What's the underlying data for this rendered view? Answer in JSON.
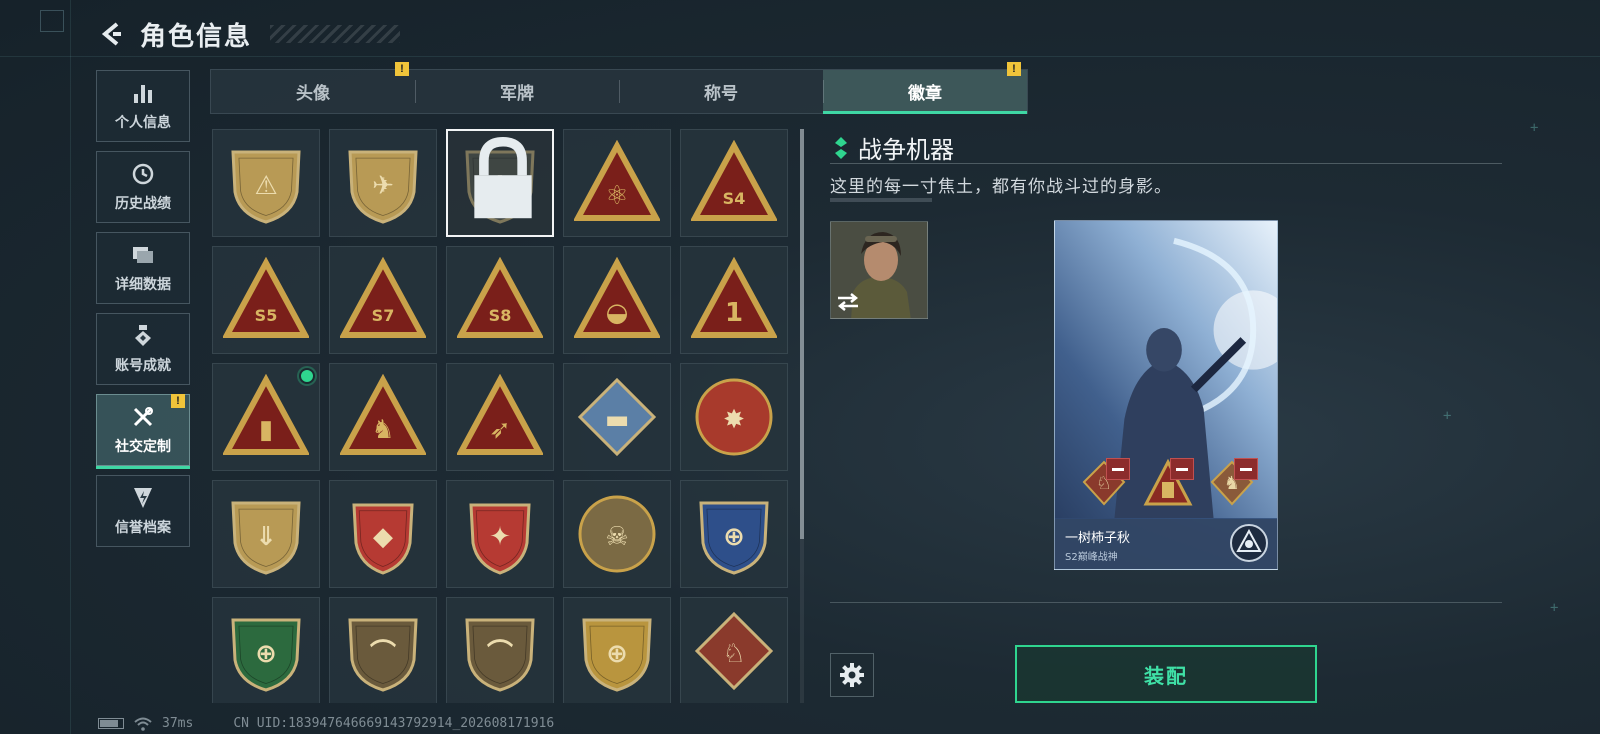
{
  "header": {
    "title": "角色信息"
  },
  "nav": {
    "items": [
      {
        "label": "个人信息",
        "icon": "bar-chart-icon",
        "active": false
      },
      {
        "label": "历史战绩",
        "icon": "history-icon",
        "active": false
      },
      {
        "label": "详细数据",
        "icon": "folder-icon",
        "active": false
      },
      {
        "label": "账号成就",
        "icon": "medal-icon",
        "active": false
      },
      {
        "label": "社交定制",
        "icon": "tools-icon",
        "active": true,
        "warning": true
      },
      {
        "label": "信誉档案",
        "icon": "shield-lightning-icon",
        "active": false
      }
    ],
    "warning_glyph": "!"
  },
  "tabs": [
    {
      "label": "头像",
      "warning": true,
      "active": false
    },
    {
      "label": "军牌",
      "warning": false,
      "active": false
    },
    {
      "label": "称号",
      "warning": false,
      "active": false
    },
    {
      "label": "徽章",
      "warning": true,
      "active": true
    }
  ],
  "badges": [
    {
      "name": "badge-shield-triangle",
      "shape": "shield",
      "color": "#b89a55",
      "symbol": "⚠",
      "selected": false
    },
    {
      "name": "badge-helicopter",
      "shape": "shield",
      "color": "#b89a55",
      "symbol": "✈",
      "selected": false
    },
    {
      "name": "badge-dagger",
      "shape": "shield",
      "color": "#55584e",
      "symbol": "†",
      "selected": true,
      "locked": true
    },
    {
      "name": "badge-atom",
      "shape": "triangle",
      "color": "#c9a24a",
      "symbol": "⚛",
      "selected": false
    },
    {
      "name": "badge-s4",
      "shape": "triangle",
      "color": "#c9a24a",
      "symbol": "S4",
      "selected": false
    },
    {
      "name": "badge-s5",
      "shape": "triangle",
      "color": "#c9a24a",
      "symbol": "S5",
      "selected": false
    },
    {
      "name": "badge-s7",
      "shape": "triangle",
      "color": "#c9a24a",
      "symbol": "S7",
      "selected": false
    },
    {
      "name": "badge-s8",
      "shape": "triangle",
      "color": "#c9a24a",
      "symbol": "S8",
      "selected": false
    },
    {
      "name": "badge-nest",
      "shape": "triangle",
      "color": "#c9a24a",
      "symbol": "◒",
      "selected": false
    },
    {
      "name": "badge-number-one",
      "shape": "triangle",
      "color": "#c9a24a",
      "symbol": "1",
      "selected": false
    },
    {
      "name": "badge-usb",
      "shape": "triangle",
      "color": "#c9a24a",
      "symbol": "▮",
      "selected": false,
      "new": true
    },
    {
      "name": "badge-soldiers",
      "shape": "triangle",
      "color": "#c9a24a",
      "symbol": "♞",
      "selected": false
    },
    {
      "name": "badge-rocket",
      "shape": "triangle",
      "color": "#c9a24a",
      "symbol": "➶",
      "selected": false
    },
    {
      "name": "badge-tank",
      "shape": "diamond",
      "color": "#5b7fa6",
      "symbol": "▬",
      "selected": false
    },
    {
      "name": "badge-star-skull",
      "shape": "circle",
      "color": "#a83a2c",
      "symbol": "✸",
      "selected": false
    },
    {
      "name": "badge-arrow-shield",
      "shape": "shield",
      "color": "#b89a55",
      "symbol": "⇓",
      "selected": false
    },
    {
      "name": "badge-red-crest-1",
      "shape": "crest",
      "color": "#b63a33",
      "symbol": "◆",
      "selected": false
    },
    {
      "name": "badge-red-crest-2",
      "shape": "crest",
      "color": "#b63a33",
      "symbol": "✦",
      "selected": false
    },
    {
      "name": "badge-gear-skull",
      "shape": "circle",
      "color": "#7b6a44",
      "symbol": "☠",
      "selected": false
    },
    {
      "name": "badge-crosshair-blue",
      "shape": "shield",
      "color": "#2e4f8a",
      "symbol": "⊕",
      "selected": false
    },
    {
      "name": "badge-crosshair-green",
      "shape": "shield",
      "color": "#2c6a3e",
      "symbol": "⊕",
      "selected": false
    },
    {
      "name": "badge-rifle-1",
      "shape": "shield",
      "color": "#6a5a3c",
      "symbol": "⌒",
      "selected": false
    },
    {
      "name": "badge-rifle-2",
      "shape": "shield",
      "color": "#6a5a3c",
      "symbol": "⌒",
      "selected": false
    },
    {
      "name": "badge-crosshair-gold",
      "shape": "shield",
      "color": "#b9953e",
      "symbol": "⊕",
      "selected": false
    },
    {
      "name": "badge-wolf",
      "shape": "diamond",
      "color": "#8a3a2c",
      "symbol": "♘",
      "selected": false
    }
  ],
  "detail": {
    "title": "战争机器",
    "description": "这里的每一寸焦土，都有你战斗过的身影。"
  },
  "card": {
    "player_name": "一树柿子秋",
    "subtitle": "S2巅峰战神"
  },
  "equip_button": "装配",
  "status": {
    "ping": "37ms",
    "uid": "CN UID:1839476466691437929​14_202608171916"
  },
  "colors": {
    "accent": "#3fd7a4",
    "warning": "#f0c43a",
    "remove": "#8c2c2c"
  }
}
